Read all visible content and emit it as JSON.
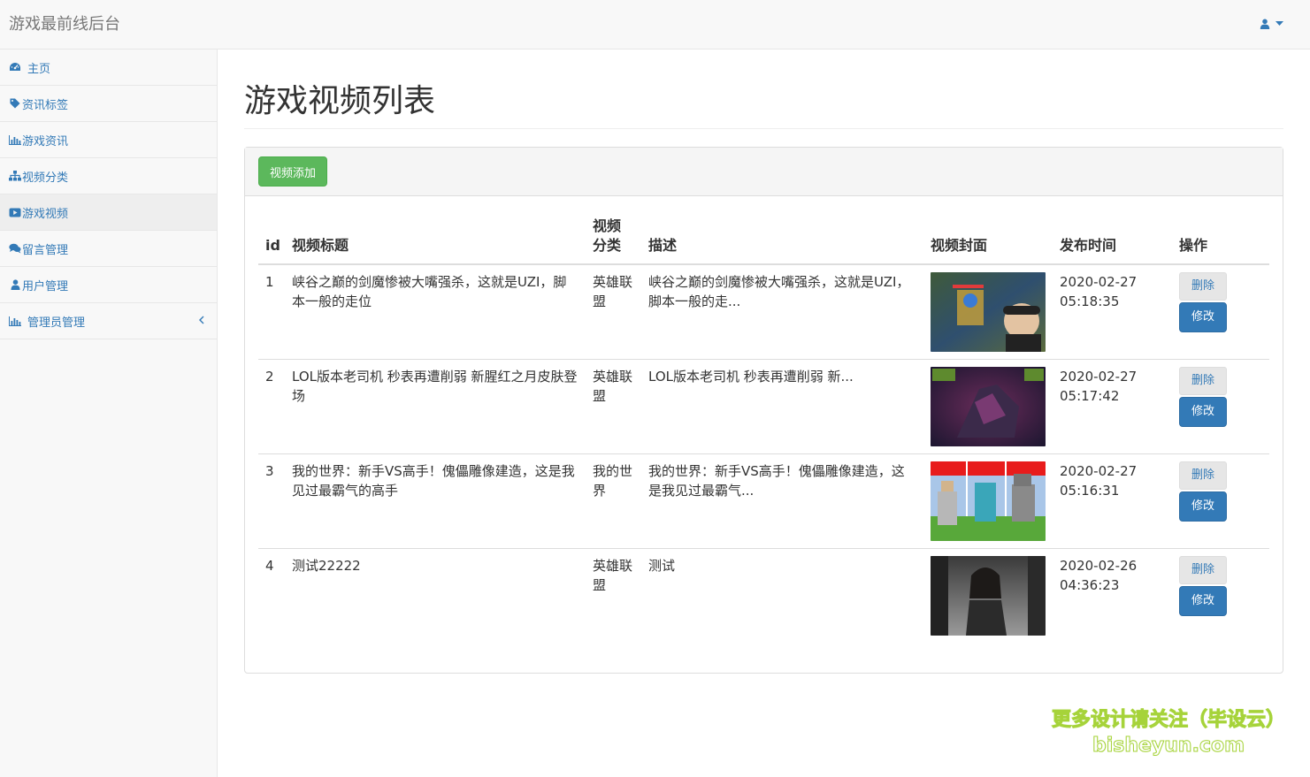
{
  "app": {
    "brand": "游戏最前线后台"
  },
  "sidebar": {
    "items": [
      {
        "label": "主页",
        "icon": "dashboard-icon"
      },
      {
        "label": "资讯标签",
        "icon": "tag-icon"
      },
      {
        "label": "游戏资讯",
        "icon": "bar-chart-icon"
      },
      {
        "label": "视频分类",
        "icon": "sitemap-icon"
      },
      {
        "label": "游戏视频",
        "icon": "video-icon",
        "active": true
      },
      {
        "label": "留言管理",
        "icon": "comments-icon"
      },
      {
        "label": "用户管理",
        "icon": "user-icon"
      },
      {
        "label": "管理员管理",
        "icon": "bar-chart-icon"
      }
    ]
  },
  "main": {
    "title": "游戏视频列表",
    "add_button": "视频添加",
    "table": {
      "headers": [
        "id",
        "视频标题",
        "视频分类",
        "描述",
        "视频封面",
        "发布时间",
        "操作"
      ],
      "rows": [
        {
          "id": "1",
          "title": "峡谷之巅的剑魔惨被大嘴强杀，这就是UZI，脚本一般的走位",
          "category": "英雄联盟",
          "desc": "峡谷之巅的剑魔惨被大嘴强杀，这就是UZI，脚本一般的走...",
          "date": "2020-02-27",
          "time": "05:18:35"
        },
        {
          "id": "2",
          "title": "LOL版本老司机 秒表再遭削弱 新腥红之月皮肤登场",
          "category": "英雄联盟",
          "desc": "LOL版本老司机 秒表再遭削弱 新...",
          "date": "2020-02-27",
          "time": "05:17:42"
        },
        {
          "id": "3",
          "title": "我的世界：新手VS高手！傀儡雕像建造，这是我见过最霸气的高手",
          "category": "我的世界",
          "desc": "我的世界：新手VS高手！傀儡雕像建造，这是我见过最霸气...",
          "date": "2020-02-27",
          "time": "05:16:31"
        },
        {
          "id": "4",
          "title": "测试22222",
          "category": "英雄联盟",
          "desc": "测试",
          "date": "2020-02-26",
          "time": "04:36:23"
        }
      ],
      "delete_label": "删除",
      "edit_label": "修改"
    }
  },
  "watermark": {
    "line1": "更多设计请关注（毕设云）",
    "line2": "bisheyun.com"
  },
  "colors": {
    "link": "#337ab7",
    "success": "#5cb85c",
    "primary": "#337ab7",
    "watermark": "#a6d33a"
  }
}
